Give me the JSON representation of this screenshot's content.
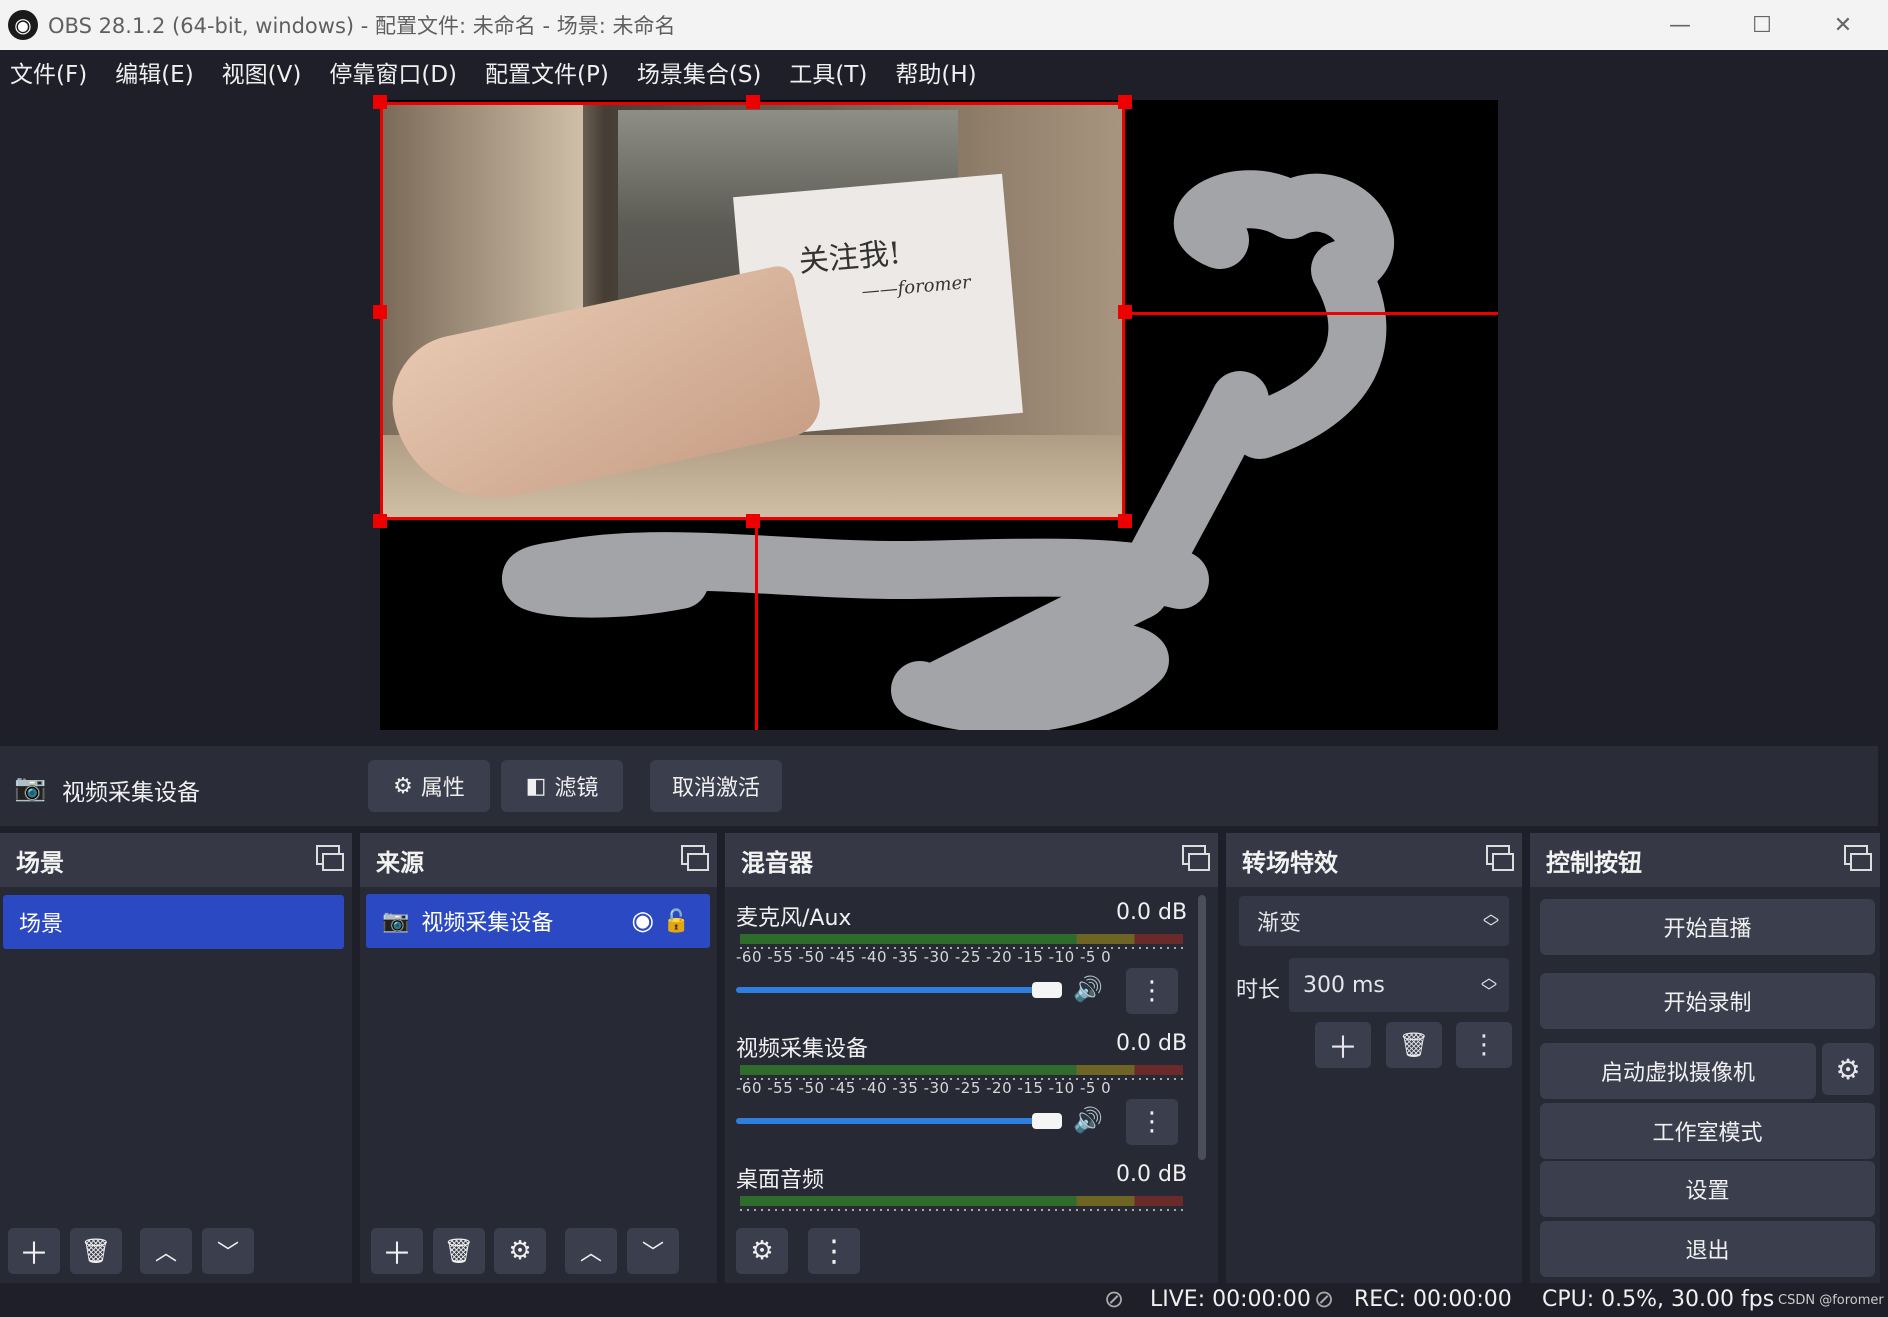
{
  "window": {
    "title": "OBS 28.1.2 (64-bit, windows) - 配置文件: 未命名 - 场景: 未命名",
    "minimize": "—",
    "maximize": "☐",
    "close": "✕"
  },
  "menu": [
    "文件(F)",
    "编辑(E)",
    "视图(V)",
    "停靠窗口(D)",
    "配置文件(P)",
    "场景集合(S)",
    "工具(T)",
    "帮助(H)"
  ],
  "preview": {
    "note_text": "关注我!",
    "note_sign": "——foromer"
  },
  "source_toolbar": {
    "source_name": "视频采集设备",
    "properties": "属性",
    "filters": "滤镜",
    "deactivate": "取消激活"
  },
  "docks": {
    "scenes": {
      "title": "场景",
      "items": [
        "场景"
      ]
    },
    "sources": {
      "title": "来源",
      "items": [
        "视频采集设备"
      ]
    },
    "mixer": {
      "title": "混音器",
      "ticks": "-60 -55 -50 -45 -40 -35 -30 -25 -20 -15 -10 -5 0",
      "channels": [
        {
          "name": "麦克风/Aux",
          "db": "0.0 dB"
        },
        {
          "name": "视频采集设备",
          "db": "0.0 dB"
        },
        {
          "name": "桌面音频",
          "db": "0.0 dB"
        }
      ]
    },
    "transitions": {
      "title": "转场特效",
      "selected": "渐变",
      "duration_label": "时长",
      "duration_value": "300 ms"
    },
    "controls": {
      "title": "控制按钮",
      "buttons": [
        "开始直播",
        "开始录制",
        "启动虚拟摄像机",
        "工作室模式",
        "设置",
        "退出"
      ]
    }
  },
  "status": {
    "live": "LIVE: 00:00:00",
    "rec": "REC: 00:00:00",
    "cpu": "CPU: 0.5%, 30.00 fps",
    "watermark": "CSDN @foromer"
  },
  "colors": {
    "accent": "#2c49c4",
    "selection": "#ee0000",
    "background": "#1e1f29"
  }
}
